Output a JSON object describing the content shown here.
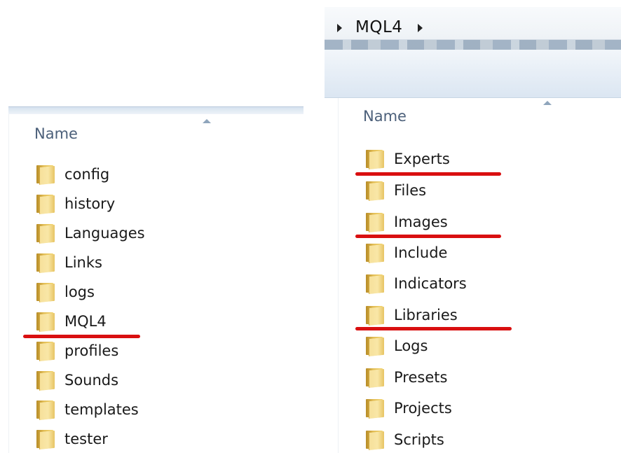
{
  "left": {
    "column_header": "Name",
    "folders": [
      "config",
      "history",
      "Languages",
      "Links",
      "logs",
      "MQL4",
      "profiles",
      "Sounds",
      "templates",
      "tester"
    ]
  },
  "right": {
    "breadcrumb": "MQL4",
    "column_header": "Name",
    "folders": [
      "Experts",
      "Files",
      "Images",
      "Include",
      "Indicators",
      "Libraries",
      "Logs",
      "Presets",
      "Projects",
      "Scripts"
    ]
  },
  "colors": {
    "highlight": "#d90f10",
    "header_text": "#4c607a",
    "folder": "#f3d774"
  }
}
